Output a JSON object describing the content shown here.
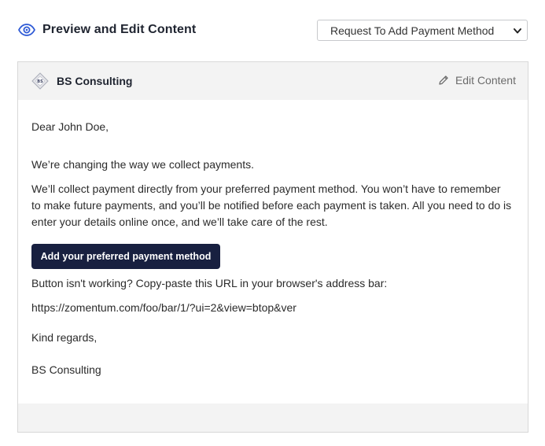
{
  "header": {
    "title": "Preview and Edit Content",
    "icon": "eye-icon",
    "template_select": {
      "selected": "Request To Add Payment Method"
    }
  },
  "card": {
    "company_name": "BS Consulting",
    "edit_label": "Edit Content",
    "email": {
      "greeting": "Dear John Doe,",
      "intro": "We’re changing the way we collect payments.",
      "paragraph": "We’ll collect payment directly from your preferred payment method. You won’t have to remember to make future payments, and you’ll be notified before each payment is taken. All you need to do is enter your details online once, and we’ll take care of the rest.",
      "button_label": "Add your preferred payment method",
      "fallback_text": "Button isn't working? Copy-paste this URL in your browser's address bar:",
      "url": "https://zomentum.com/foo/bar/1/?ui=2&view=btop&ver",
      "closing": "Kind regards,",
      "signature": "BS Consulting"
    }
  },
  "colors": {
    "accent": "#2f5bd6",
    "button_bg": "#182040",
    "header_bg": "#f3f3f3"
  }
}
